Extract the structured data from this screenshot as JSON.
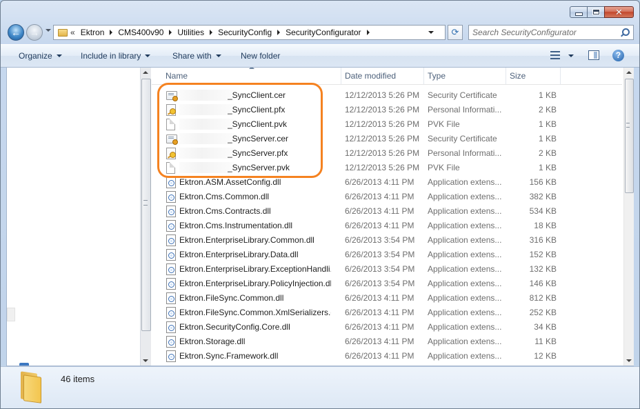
{
  "window": {
    "caption_buttons": [
      "minimize",
      "maximize",
      "close"
    ]
  },
  "address": {
    "prefix": "«",
    "crumbs": [
      "Ektron",
      "CMS400v90",
      "Utilities",
      "SecurityConfig",
      "SecurityConfigurator"
    ]
  },
  "search": {
    "placeholder": "Search SecurityConfigurator"
  },
  "toolbar": {
    "organize": "Organize",
    "include_in_library": "Include in library",
    "share_with": "Share with",
    "new_folder": "New folder"
  },
  "columns": {
    "name": "Name",
    "date": "Date modified",
    "type": "Type",
    "size": "Size"
  },
  "files": [
    {
      "name": "_SyncClient.cer",
      "date": "12/12/2013 5:26 PM",
      "type": "Security Certificate",
      "size": "1 KB",
      "icon": "certificate-icon",
      "redacted": true
    },
    {
      "name": "_SyncClient.pfx",
      "date": "12/12/2013 5:26 PM",
      "type": "Personal Informati...",
      "size": "2 KB",
      "icon": "pfx-icon",
      "redacted": true
    },
    {
      "name": "_SyncClient.pvk",
      "date": "12/12/2013 5:26 PM",
      "type": "PVK File",
      "size": "1 KB",
      "icon": "blank-file-icon",
      "redacted": true
    },
    {
      "name": "_SyncServer.cer",
      "date": "12/12/2013 5:26 PM",
      "type": "Security Certificate",
      "size": "1 KB",
      "icon": "certificate-icon",
      "redacted": true
    },
    {
      "name": "_SyncServer.pfx",
      "date": "12/12/2013 5:26 PM",
      "type": "Personal Informati...",
      "size": "2 KB",
      "icon": "pfx-icon",
      "redacted": true
    },
    {
      "name": "_SyncServer.pvk",
      "date": "12/12/2013 5:26 PM",
      "type": "PVK File",
      "size": "1 KB",
      "icon": "blank-file-icon",
      "redacted": true
    },
    {
      "name": "Ektron.ASM.AssetConfig.dll",
      "date": "6/26/2013 4:11 PM",
      "type": "Application extens...",
      "size": "156 KB",
      "icon": "dll-icon"
    },
    {
      "name": "Ektron.Cms.Common.dll",
      "date": "6/26/2013 4:11 PM",
      "type": "Application extens...",
      "size": "382 KB",
      "icon": "dll-icon"
    },
    {
      "name": "Ektron.Cms.Contracts.dll",
      "date": "6/26/2013 4:11 PM",
      "type": "Application extens...",
      "size": "534 KB",
      "icon": "dll-icon"
    },
    {
      "name": "Ektron.Cms.Instrumentation.dll",
      "date": "6/26/2013 4:11 PM",
      "type": "Application extens...",
      "size": "18 KB",
      "icon": "dll-icon"
    },
    {
      "name": "Ektron.EnterpriseLibrary.Common.dll",
      "date": "6/26/2013 3:54 PM",
      "type": "Application extens...",
      "size": "316 KB",
      "icon": "dll-icon"
    },
    {
      "name": "Ektron.EnterpriseLibrary.Data.dll",
      "date": "6/26/2013 3:54 PM",
      "type": "Application extens...",
      "size": "152 KB",
      "icon": "dll-icon"
    },
    {
      "name": "Ektron.EnterpriseLibrary.ExceptionHandli...",
      "date": "6/26/2013 3:54 PM",
      "type": "Application extens...",
      "size": "132 KB",
      "icon": "dll-icon"
    },
    {
      "name": "Ektron.EnterpriseLibrary.PolicyInjection.dll",
      "date": "6/26/2013 3:54 PM",
      "type": "Application extens...",
      "size": "146 KB",
      "icon": "dll-icon"
    },
    {
      "name": "Ektron.FileSync.Common.dll",
      "date": "6/26/2013 4:11 PM",
      "type": "Application extens...",
      "size": "812 KB",
      "icon": "dll-icon"
    },
    {
      "name": "Ektron.FileSync.Common.XmlSerializers.dll",
      "date": "6/26/2013 4:11 PM",
      "type": "Application extens...",
      "size": "252 KB",
      "icon": "dll-icon"
    },
    {
      "name": "Ektron.SecurityConfig.Core.dll",
      "date": "6/26/2013 4:11 PM",
      "type": "Application extens...",
      "size": "34 KB",
      "icon": "dll-icon"
    },
    {
      "name": "Ektron.Storage.dll",
      "date": "6/26/2013 4:11 PM",
      "type": "Application extens...",
      "size": "11 KB",
      "icon": "dll-icon"
    },
    {
      "name": "Ektron.Sync.Framework.dll",
      "date": "6/26/2013 4:11 PM",
      "type": "Application extens...",
      "size": "12 KB",
      "icon": "dll-icon"
    }
  ],
  "status": {
    "item_count": "46 items"
  },
  "colors": {
    "highlight": "#f58220",
    "accent": "#3c78c2"
  }
}
